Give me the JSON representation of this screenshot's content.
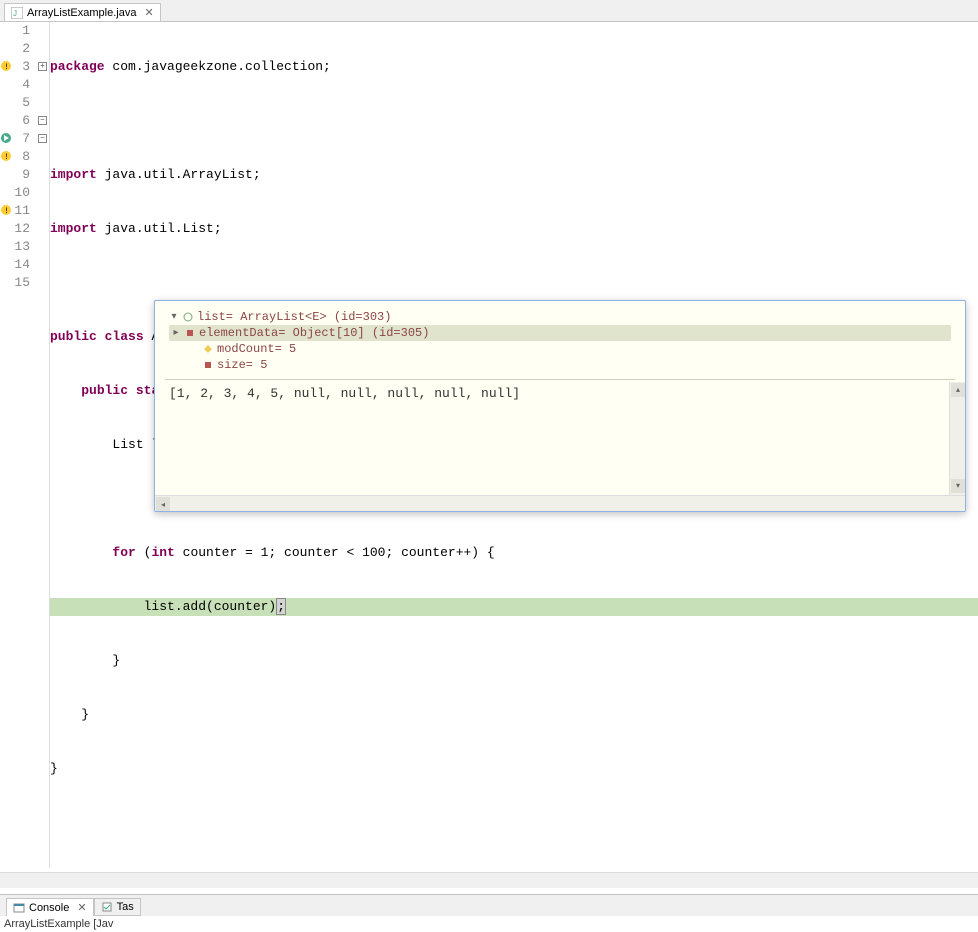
{
  "tabs": {
    "editor": {
      "filename": "ArrayListExample.java"
    },
    "console_label": "Console",
    "tasks_label": "Tas"
  },
  "code": {
    "lines": [
      "package com.javageekzone.collection;",
      "",
      "import java.util.ArrayList;",
      "import java.util.List;",
      "",
      "public class ArrayListExample {",
      "    public static void main(String[] args) {",
      "        List list = new ArrayList();",
      "",
      "        for (int counter = 1; counter < 100; counter++) {",
      "            list.add(counter);",
      "        }",
      "    }",
      "}",
      ""
    ],
    "line_numbers": [
      "1",
      "2",
      "3",
      "4",
      "5",
      "6",
      "7",
      "8",
      "9",
      "10",
      "11",
      "12",
      "13",
      "14",
      "15"
    ]
  },
  "console": {
    "launch_text": "ArrayListExample [Jav"
  },
  "popup": {
    "tree": [
      {
        "label": "list= ArrayList<E>  (id=303)",
        "expanded": true,
        "icon": "circle"
      },
      {
        "label": "elementData= Object[10]  (id=305)",
        "expanded": false,
        "icon": "square",
        "selected": true
      },
      {
        "label": "modCount= 5",
        "icon": "diamond"
      },
      {
        "label": "size= 5",
        "icon": "square"
      }
    ],
    "output": "[1, 2, 3, 4, 5, null, null, null, null, null]"
  }
}
